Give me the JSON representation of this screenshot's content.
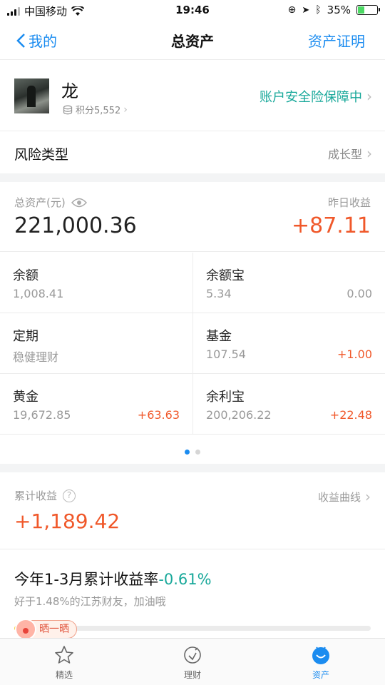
{
  "status_bar": {
    "carrier": "中国移动",
    "time": "19:46",
    "battery": "35%"
  },
  "nav": {
    "back_label": "我的",
    "title": "总资产",
    "right_label": "资产证明"
  },
  "profile": {
    "name": "龙",
    "points": "积分5,552",
    "insurance_status": "账户安全险保障中"
  },
  "risk": {
    "label": "风险类型",
    "value": "成长型"
  },
  "assets": {
    "total_label": "总资产(元)",
    "total_value": "221,000.36",
    "yesterday_label": "昨日收益",
    "yesterday_value": "+87.11",
    "items": [
      {
        "title": "余额",
        "value": "1,008.41",
        "change": ""
      },
      {
        "title": "余额宝",
        "value": "5.34",
        "change": "0.00"
      },
      {
        "title": "定期",
        "value": "稳健理财",
        "change": ""
      },
      {
        "title": "基金",
        "value": "107.54",
        "change": "+1.00"
      },
      {
        "title": "黄金",
        "value": "19,672.85",
        "change": "+63.63"
      },
      {
        "title": "余利宝",
        "value": "200,206.22",
        "change": "+22.48"
      }
    ]
  },
  "cumulative": {
    "label": "累计收益",
    "value": "+1,189.42",
    "curve_label": "收益曲线"
  },
  "rate": {
    "title": "今年1-3月累计收益率",
    "percent": "-0.61%",
    "subtitle": "好于1.48%的江苏财友，加油哦",
    "share_label": "晒一晒"
  },
  "tabs": [
    {
      "label": "精选",
      "icon": "star-icon"
    },
    {
      "label": "理财",
      "icon": "wealth-icon"
    },
    {
      "label": "资产",
      "icon": "assets-icon"
    }
  ],
  "colors": {
    "accent": "#1b8cf0",
    "gain": "#f0582a",
    "teal": "#18a89a"
  }
}
